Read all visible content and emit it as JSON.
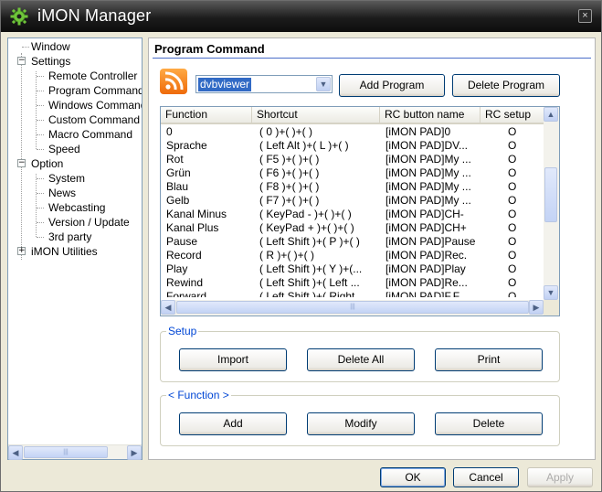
{
  "window": {
    "title": "iMON Manager",
    "close_glyph": "×",
    "icons": {
      "logo": "gear-icon",
      "close": "close-icon"
    }
  },
  "tree": {
    "items": [
      {
        "label": "Window",
        "level": 1
      },
      {
        "label": "Settings",
        "level": 0,
        "expander": "−"
      },
      {
        "label": "Remote Controller",
        "level": 1
      },
      {
        "label": "Program Command",
        "level": 1,
        "selected": true
      },
      {
        "label": "Windows Command",
        "level": 1
      },
      {
        "label": "Custom Command",
        "level": 1
      },
      {
        "label": "Macro Command",
        "level": 1
      },
      {
        "label": "Speed",
        "level": 1
      },
      {
        "label": "Option",
        "level": 0,
        "expander": "−"
      },
      {
        "label": "System",
        "level": 1
      },
      {
        "label": "News",
        "level": 1
      },
      {
        "label": "Webcasting",
        "level": 1
      },
      {
        "label": "Version / Update",
        "level": 1
      },
      {
        "label": "3rd party",
        "level": 1
      },
      {
        "label": "iMON Utilities",
        "level": 0,
        "expander": "+"
      }
    ],
    "scroll_left": "◀",
    "scroll_right": "▶",
    "thumb_grip": "|||"
  },
  "panel": {
    "title": "Program Command",
    "program_select": {
      "value": "dvbviewer",
      "arrow": "▼"
    },
    "add_program_label": "Add Program",
    "delete_program_label": "Delete Program",
    "icons": {
      "program": "rss-icon"
    }
  },
  "list": {
    "columns": [
      "Function",
      "Shortcut",
      "RC button name",
      "RC setup"
    ],
    "rows": [
      [
        "0",
        "( 0 )+(  )+(  )",
        "[iMON PAD]0",
        "O"
      ],
      [
        "Sprache",
        "( Left Alt )+( L )+(  )",
        "[iMON PAD]DV...",
        "O"
      ],
      [
        "Rot",
        "( F5 )+(  )+(  )",
        "[iMON PAD]My ...",
        "O"
      ],
      [
        "Grün",
        "( F6 )+(  )+(  )",
        "[iMON PAD]My ...",
        "O"
      ],
      [
        "Blau",
        "( F8 )+(  )+(  )",
        "[iMON PAD]My ...",
        "O"
      ],
      [
        "Gelb",
        "( F7 )+(  )+(  )",
        "[iMON PAD]My ...",
        "O"
      ],
      [
        "Kanal Minus",
        "( KeyPad - )+(  )+(  )",
        "[iMON PAD]CH-",
        "O"
      ],
      [
        "Kanal Plus",
        "( KeyPad + )+(  )+(  )",
        "[iMON PAD]CH+",
        "O"
      ],
      [
        "Pause",
        "( Left Shift )+( P )+(  )",
        "[iMON PAD]Pause",
        "O"
      ],
      [
        "Record",
        "( R )+(  )+(  )",
        "[iMON PAD]Rec.",
        "O"
      ],
      [
        "Play",
        "( Left Shift )+( Y )+(...",
        "[iMON PAD]Play",
        "O"
      ],
      [
        "Rewind",
        "( Left Shift )+( Left ...",
        "[iMON PAD]Re...",
        "O"
      ],
      [
        "Forward",
        "( Left Shift )+( Right ...",
        "[iMON PAD]F.F.",
        "O"
      ]
    ],
    "scroll_up": "▲",
    "scroll_down": "▼",
    "scroll_left": "◀",
    "scroll_right": "▶",
    "thumb_grip": "|||"
  },
  "setup": {
    "label": "Setup",
    "import_label": "Import",
    "delete_all_label": "Delete All",
    "print_label": "Print"
  },
  "function": {
    "label": "< Function >",
    "add_label": "Add",
    "modify_label": "Modify",
    "delete_label": "Delete"
  },
  "footer": {
    "ok_label": "OK",
    "cancel_label": "Cancel",
    "apply_label": "Apply"
  },
  "colors": {
    "title_bg": "#1c1c1c",
    "selection": "#316ac5",
    "group_label": "#0046d5",
    "rule": "#4a6ec9"
  }
}
